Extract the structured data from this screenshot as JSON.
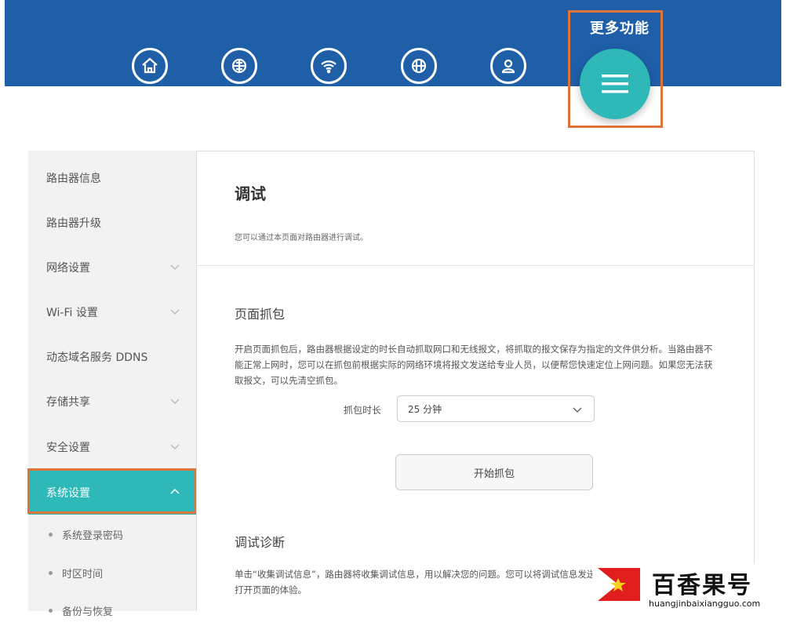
{
  "header": {
    "more_label": "更多功能",
    "nav_icons": [
      "home-icon",
      "network-icon",
      "wifi-icon",
      "device-icon",
      "user-icon"
    ],
    "more_icon": "menu-icon"
  },
  "sidebar": {
    "items": [
      {
        "label": "路由器信息",
        "chevron": false
      },
      {
        "label": "路由器升级",
        "chevron": false
      },
      {
        "label": "网络设置",
        "chevron": true
      },
      {
        "label": "Wi-Fi 设置",
        "chevron": true
      },
      {
        "label": "动态域名服务 DDNS",
        "chevron": false
      },
      {
        "label": "存储共享",
        "chevron": true
      },
      {
        "label": "安全设置",
        "chevron": true
      },
      {
        "label": "系统设置",
        "chevron": true,
        "active": true
      }
    ],
    "sub_items": [
      "系统登录密码",
      "时区时间",
      "备份与恢复"
    ]
  },
  "main": {
    "title": "调试",
    "description": "您可以通过本页面对路由器进行调试。",
    "section1": {
      "title": "页面抓包",
      "text": "开启页面抓包后，路由器根据设定的时长自动抓取网口和无线报文，将抓取的报文保存为指定的文件供分析。当路由器不能正常上网时，您可以在抓包前根据实际的网络环境将报文发送给专业人员，以便帮您快速定位上网问题。如果您无法获取报文，可以先清空抓包。",
      "duration_label": "抓包时长",
      "duration_value": "25 分钟",
      "start_button": "开始抓包"
    },
    "section2": {
      "title": "调试诊断",
      "text": "单击“收集调试信息”，路由器将收集调试信息，用以解决您的问题。您可以将调试信息发送给技术支持人员。请注意允许打开页面的体验。"
    },
    "chevron_icon": "chevron-down-icon"
  },
  "watermark": {
    "brand": "百香果号",
    "domain": "huangjinbaixiangguo.com"
  },
  "colors": {
    "header_blue": "#1f5fa8",
    "accent_teal": "#2fb8b8",
    "highlight_orange": "#e0733a"
  }
}
